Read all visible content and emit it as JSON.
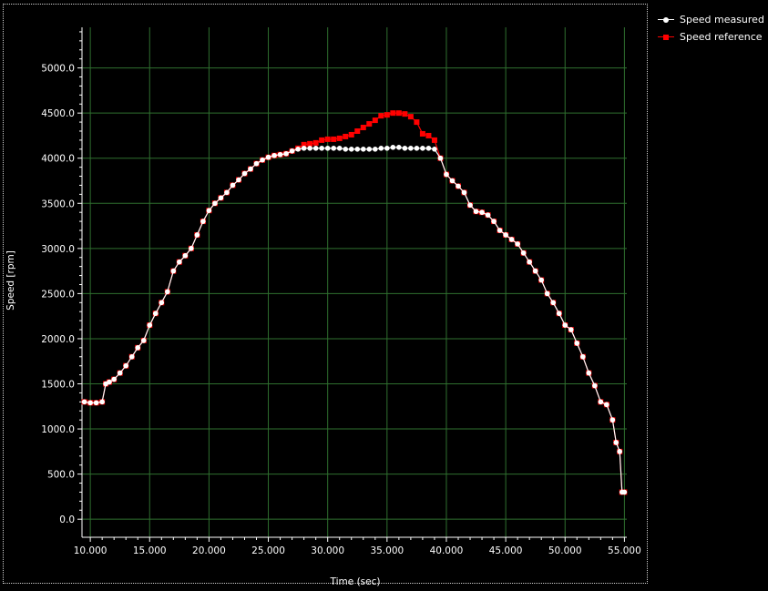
{
  "chart_data": {
    "type": "line",
    "title": "",
    "xlabel": "Time (sec)",
    "ylabel": "Speed [rpm]",
    "xlim": [
      9.3,
      55.2
    ],
    "ylim": [
      -200,
      5450
    ],
    "grid": true,
    "legend_position": "top-right, outside plot",
    "x_ticks": [
      10.0,
      15.0,
      20.0,
      25.0,
      30.0,
      35.0,
      40.0,
      45.0,
      50.0,
      55.0
    ],
    "x_tick_labels": [
      "10.000",
      "15.000",
      "20.000",
      "25.000",
      "30.000",
      "35.000",
      "40.000",
      "45.000",
      "50.000",
      "55.000"
    ],
    "y_ticks": [
      0,
      500,
      1000,
      1500,
      2000,
      2500,
      3000,
      3500,
      4000,
      4500,
      5000
    ],
    "y_tick_labels": [
      "0.0",
      "500.0",
      "1000.0",
      "1500.0",
      "2000.0",
      "2500.0",
      "3000.0",
      "3500.0",
      "4000.0",
      "4500.0",
      "5000.0"
    ],
    "series": [
      {
        "name": "Speed reference",
        "color": "#ff0000",
        "marker": "square",
        "x": [
          9.5,
          10.0,
          10.5,
          11.0,
          11.3,
          11.6,
          12.0,
          12.5,
          13.0,
          13.5,
          14.0,
          14.5,
          15.0,
          15.5,
          16.0,
          16.5,
          17.0,
          17.5,
          18.0,
          18.5,
          19.0,
          19.5,
          20.0,
          20.5,
          21.0,
          21.5,
          22.0,
          22.5,
          23.0,
          23.5,
          24.0,
          24.5,
          25.0,
          25.5,
          26.0,
          26.5,
          27.0,
          27.5,
          28.0,
          28.5,
          29.0,
          29.5,
          30.0,
          30.5,
          31.0,
          31.5,
          32.0,
          32.5,
          33.0,
          33.5,
          34.0,
          34.5,
          35.0,
          35.5,
          36.0,
          36.5,
          37.0,
          37.5,
          38.0,
          38.5,
          39.0,
          39.5,
          40.0,
          40.5,
          41.0,
          41.5,
          42.0,
          42.5,
          43.0,
          43.5,
          44.0,
          44.5,
          45.0,
          45.5,
          46.0,
          46.5,
          47.0,
          47.5,
          48.0,
          48.5,
          49.0,
          49.5,
          50.0,
          50.5,
          51.0,
          51.5,
          52.0,
          52.5,
          53.0,
          53.5,
          54.0,
          54.3,
          54.6,
          54.8,
          55.0
        ],
        "y": [
          1300,
          1290,
          1290,
          1300,
          1500,
          1520,
          1550,
          1620,
          1700,
          1800,
          1900,
          1980,
          2150,
          2280,
          2400,
          2520,
          2750,
          2850,
          2920,
          3000,
          3150,
          3300,
          3420,
          3500,
          3560,
          3620,
          3700,
          3760,
          3830,
          3880,
          3940,
          3980,
          4010,
          4030,
          4040,
          4050,
          4080,
          4110,
          4150,
          4160,
          4170,
          4200,
          4210,
          4210,
          4220,
          4240,
          4260,
          4300,
          4340,
          4380,
          4420,
          4470,
          4480,
          4500,
          4500,
          4490,
          4460,
          4400,
          4270,
          4250,
          4200,
          4000,
          3820,
          3750,
          3690,
          3620,
          3480,
          3410,
          3400,
          3370,
          3300,
          3200,
          3150,
          3100,
          3050,
          2950,
          2850,
          2750,
          2650,
          2500,
          2400,
          2280,
          2150,
          2100,
          1950,
          1800,
          1620,
          1480,
          1300,
          1270,
          1100,
          850,
          750,
          300,
          300
        ],
        "z": 0
      },
      {
        "name": "Speed measured",
        "color": "#ffffff",
        "marker": "circle",
        "x": [
          9.5,
          10.0,
          10.5,
          11.0,
          11.3,
          11.6,
          12.0,
          12.5,
          13.0,
          13.5,
          14.0,
          14.5,
          15.0,
          15.5,
          16.0,
          16.5,
          17.0,
          17.5,
          18.0,
          18.5,
          19.0,
          19.5,
          20.0,
          20.5,
          21.0,
          21.5,
          22.0,
          22.5,
          23.0,
          23.5,
          24.0,
          24.5,
          25.0,
          25.5,
          26.0,
          26.5,
          27.0,
          27.5,
          28.0,
          28.5,
          29.0,
          29.5,
          30.0,
          30.5,
          31.0,
          31.5,
          32.0,
          32.5,
          33.0,
          33.5,
          34.0,
          34.5,
          35.0,
          35.5,
          36.0,
          36.5,
          37.0,
          37.5,
          38.0,
          38.5,
          39.0,
          39.5,
          40.0,
          40.5,
          41.0,
          41.5,
          42.0,
          42.5,
          43.0,
          43.5,
          44.0,
          44.5,
          45.0,
          45.5,
          46.0,
          46.5,
          47.0,
          47.5,
          48.0,
          48.5,
          49.0,
          49.5,
          50.0,
          50.5,
          51.0,
          51.5,
          52.0,
          52.5,
          53.0,
          53.5,
          54.0,
          54.3,
          54.6,
          54.8,
          55.0
        ],
        "y": [
          1300,
          1290,
          1290,
          1300,
          1500,
          1520,
          1550,
          1620,
          1700,
          1800,
          1900,
          1980,
          2150,
          2280,
          2400,
          2520,
          2750,
          2850,
          2920,
          3000,
          3150,
          3300,
          3420,
          3500,
          3560,
          3620,
          3700,
          3760,
          3830,
          3880,
          3940,
          3980,
          4010,
          4030,
          4040,
          4050,
          4080,
          4100,
          4110,
          4110,
          4110,
          4110,
          4110,
          4110,
          4110,
          4100,
          4100,
          4100,
          4100,
          4100,
          4100,
          4110,
          4110,
          4120,
          4120,
          4110,
          4110,
          4110,
          4110,
          4110,
          4100,
          4000,
          3820,
          3750,
          3690,
          3620,
          3480,
          3410,
          3400,
          3370,
          3300,
          3200,
          3150,
          3100,
          3050,
          2950,
          2850,
          2750,
          2650,
          2500,
          2400,
          2280,
          2150,
          2100,
          1950,
          1800,
          1620,
          1480,
          1300,
          1270,
          1100,
          850,
          750,
          300,
          300
        ]
      }
    ]
  },
  "legend": {
    "items": [
      {
        "label": "Speed measured",
        "color": "#ffffff",
        "marker": "circle"
      },
      {
        "label": "Speed reference",
        "color": "#ff0000",
        "marker": "square"
      }
    ]
  },
  "colors": {
    "background": "#000000",
    "grid": "#2f6f2f",
    "axis": "#ffffff"
  }
}
